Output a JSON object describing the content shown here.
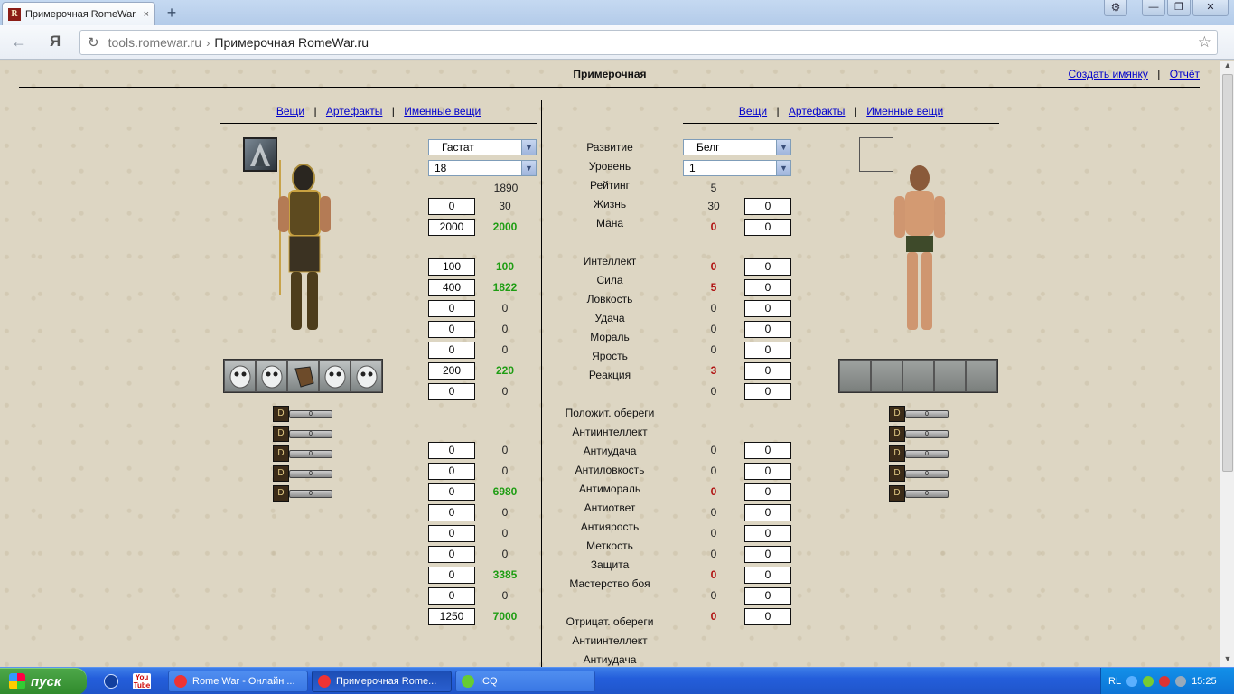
{
  "browser": {
    "tab_title": "Примерочная RomeWar",
    "tab_close": "×",
    "new_tab": "+",
    "url_host": "tools.romewar.ru",
    "url_sep": "›",
    "url_title": "Примерочная RomeWar.ru",
    "yandex_logo": "Я",
    "back_glyph": "←",
    "reload_glyph": "↻",
    "star_glyph": "☆",
    "settings_glyph": "⚙",
    "minimize_glyph": "—",
    "restore_glyph": "❐",
    "close_glyph": "✕"
  },
  "page": {
    "title": "Примерочная",
    "create_nameplate_link": "Создать имянку",
    "report_link": "Отчёт",
    "link_sep": "|"
  },
  "nav": {
    "items_label": "Вещи",
    "artifacts_label": "Артефакты",
    "named_items_label": "Именные вещи",
    "sep": "|"
  },
  "left": {
    "class_select": "Гастат",
    "level_select": "18",
    "rating": "1890",
    "rows": [
      {
        "input": "0",
        "value": "30",
        "color": "plain"
      },
      {
        "input": "2000",
        "value": "2000",
        "color": "green"
      },
      {
        "input": "100",
        "value": "100",
        "color": "green"
      },
      {
        "input": "400",
        "value": "1822",
        "color": "green"
      },
      {
        "input": "0",
        "value": "0",
        "color": "plain"
      },
      {
        "input": "0",
        "value": "0",
        "color": "plain"
      },
      {
        "input": "0",
        "value": "0",
        "color": "plain"
      },
      {
        "input": "200",
        "value": "220",
        "color": "green"
      },
      {
        "input": "0",
        "value": "0",
        "color": "plain"
      },
      {
        "input": "0",
        "value": "0",
        "color": "plain"
      },
      {
        "input": "0",
        "value": "0",
        "color": "plain"
      },
      {
        "input": "0",
        "value": "6980",
        "color": "green"
      },
      {
        "input": "0",
        "value": "0",
        "color": "plain"
      },
      {
        "input": "0",
        "value": "0",
        "color": "plain"
      },
      {
        "input": "0",
        "value": "0",
        "color": "plain"
      },
      {
        "input": "0",
        "value": "3385",
        "color": "green"
      },
      {
        "input": "0",
        "value": "0",
        "color": "plain"
      },
      {
        "input": "1250",
        "value": "7000",
        "color": "green"
      }
    ],
    "rune_meters": [
      "0",
      "0",
      "0",
      "0",
      "0"
    ]
  },
  "right": {
    "class_select": "Белг",
    "level_select": "1",
    "rating": "5",
    "rows": [
      {
        "input": "0",
        "value": "30",
        "color": "plain"
      },
      {
        "input": "0",
        "value": "0",
        "color": "red"
      },
      {
        "input": "0",
        "value": "0",
        "color": "red"
      },
      {
        "input": "0",
        "value": "5",
        "color": "red"
      },
      {
        "input": "0",
        "value": "0",
        "color": "plain"
      },
      {
        "input": "0",
        "value": "0",
        "color": "plain"
      },
      {
        "input": "0",
        "value": "0",
        "color": "plain"
      },
      {
        "input": "0",
        "value": "3",
        "color": "red"
      },
      {
        "input": "0",
        "value": "0",
        "color": "plain"
      },
      {
        "input": "0",
        "value": "0",
        "color": "plain"
      },
      {
        "input": "0",
        "value": "0",
        "color": "plain"
      },
      {
        "input": "0",
        "value": "0",
        "color": "red"
      },
      {
        "input": "0",
        "value": "0",
        "color": "plain"
      },
      {
        "input": "0",
        "value": "0",
        "color": "plain"
      },
      {
        "input": "0",
        "value": "0",
        "color": "plain"
      },
      {
        "input": "0",
        "value": "0",
        "color": "red"
      },
      {
        "input": "0",
        "value": "0",
        "color": "plain"
      },
      {
        "input": "0",
        "value": "0",
        "color": "red"
      }
    ],
    "rune_meters": [
      "0",
      "0",
      "0",
      "0",
      "0"
    ]
  },
  "labels": {
    "development": "Развитие",
    "level": "Уровень",
    "rating": "Рейтинг",
    "life": "Жизнь",
    "mana": "Мана",
    "intellect": "Интеллект",
    "strength": "Сила",
    "agility": "Ловкость",
    "luck": "Удача",
    "morale": "Мораль",
    "fury": "Ярость",
    "reaction": "Реакция",
    "positive_charms": "Положит. обереги",
    "anti_intellect": "Антиинтеллект",
    "anti_luck": "Антиудача",
    "anti_agility": "Антиловкость",
    "anti_morale": "Антимораль",
    "anti_response": "Антиответ",
    "anti_fury": "Антиярость",
    "accuracy": "Меткость",
    "defense": "Защита",
    "combat_mastery": "Мастерство боя",
    "negative_charms": "Отрицат. обереги",
    "anti_intellect_2": "Антиинтеллект",
    "anti_luck_2": "Антиудача"
  },
  "taskbar": {
    "start": "пуск",
    "youtube": "You Tube",
    "task1": "Rome War - Онлайн ...",
    "task2": "Примерочная Rome...",
    "task3": "ICQ",
    "lang": "RL",
    "clock": "15:25"
  },
  "colors": {
    "link": "#0000cc",
    "green_value": "#1e9d13",
    "red_value": "#b01010"
  }
}
